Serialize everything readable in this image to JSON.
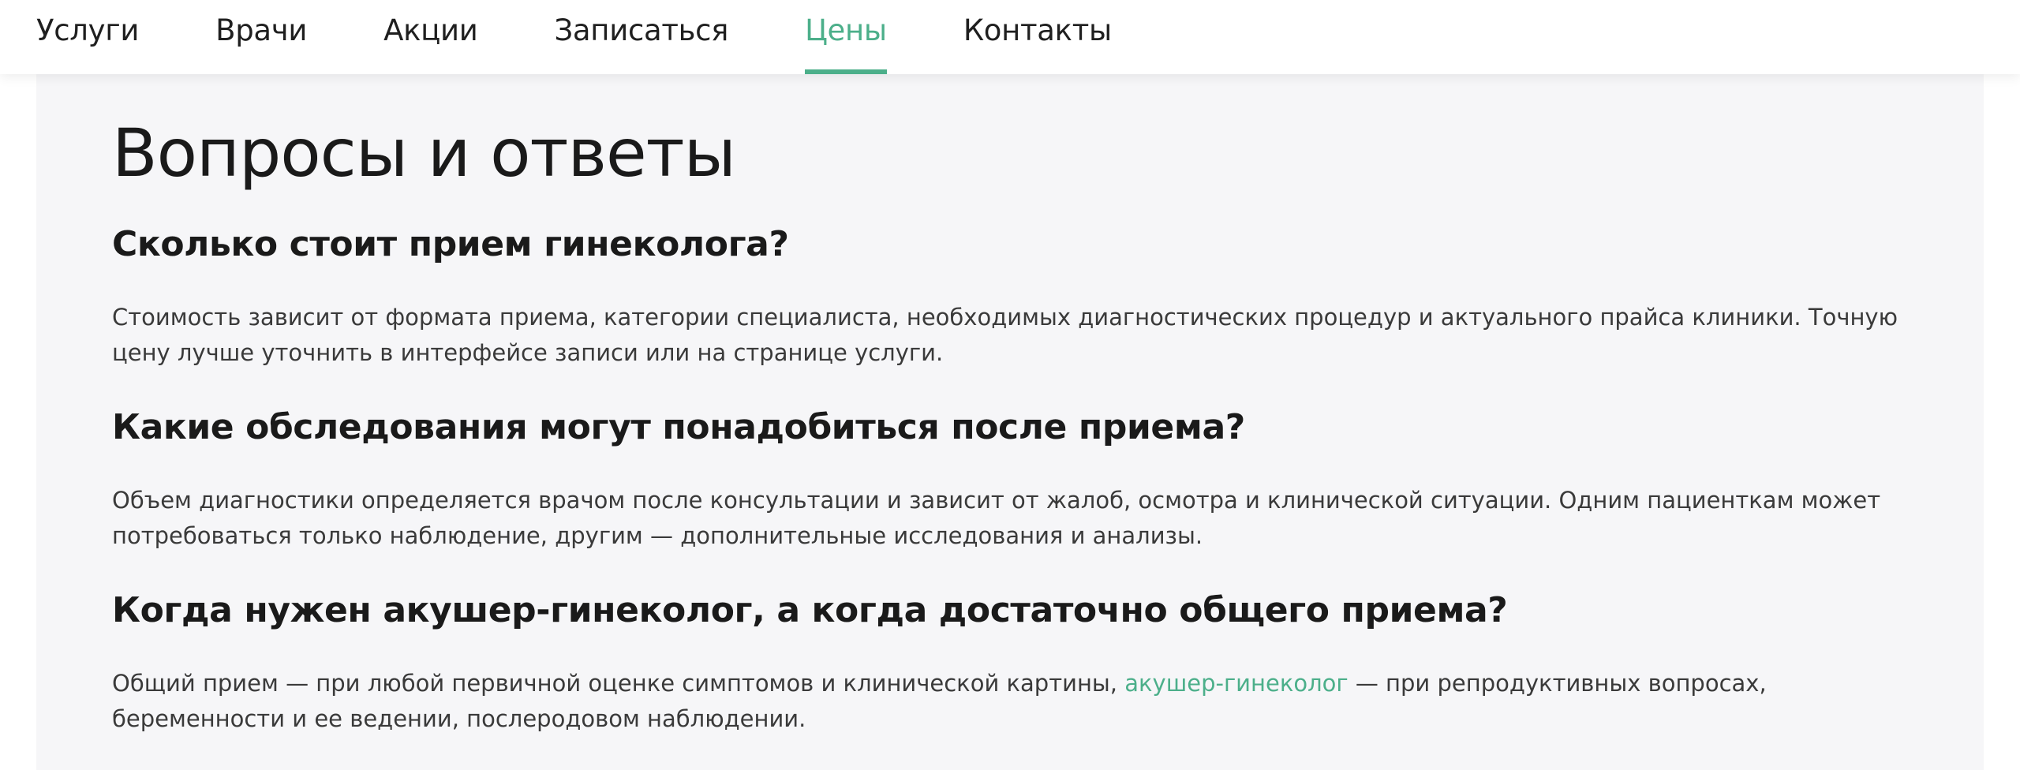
{
  "nav": {
    "items": [
      {
        "label": "Услуги"
      },
      {
        "label": "Врачи"
      },
      {
        "label": "Акции"
      },
      {
        "label": "Записаться"
      },
      {
        "label": "Цены"
      },
      {
        "label": "Контакты"
      }
    ],
    "active_label": "Цены"
  },
  "faq": {
    "title": "Вопросы и ответы",
    "items": [
      {
        "question": "Сколько стоит прием гинеколога?",
        "answer": "Стоимость зависит от формата приема, категории специалиста, необходимых диагностических процедур и актуального прайса клиники. Точную цену лучше уточнить в интерфейсе записи или на странице услуги."
      },
      {
        "question": "Какие обследования могут понадобиться после приема?",
        "answer": "Объем диагностики определяется врачом после консультации и зависит от жалоб, осмотра и клинической ситуации. Одним пациенткам может потребоваться только наблюдение, другим — дополнительные исследования и анализы."
      },
      {
        "question": "Когда нужен акушер-гинеколог, а когда достаточно общего приема?",
        "answer_before": "Общий прием — при любой первичной оценке симптомов и клинической картины, ",
        "answer_link": "акушер-гинеколог",
        "answer_after": " — при репродуктивных вопросах, беременности и ее ведении, послеродовом наблюдении."
      }
    ]
  },
  "colors": {
    "accent": "#4caf8a",
    "content_bg": "#f6f6f8",
    "text": "#1f1f1f",
    "body_text": "#3a3a3a"
  }
}
